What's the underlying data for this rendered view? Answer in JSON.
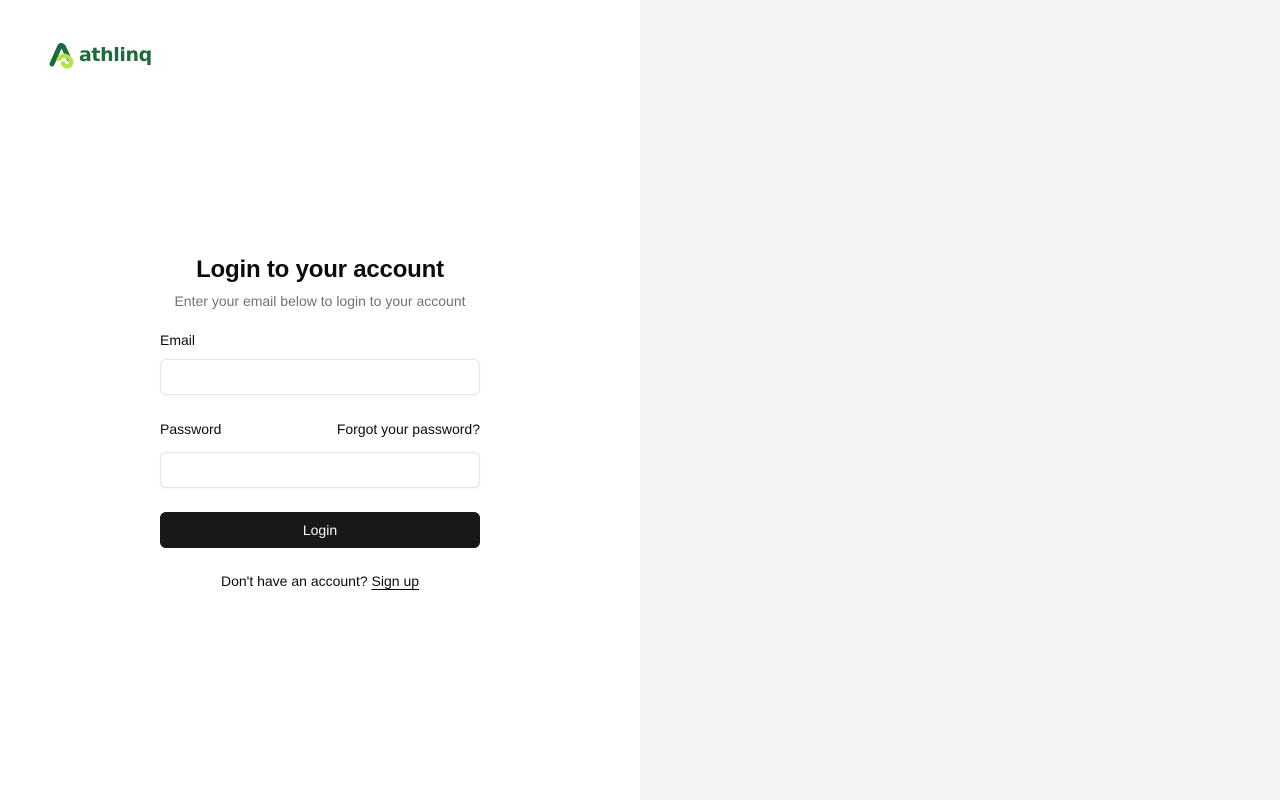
{
  "brand": {
    "name": "athlinq",
    "logo_icon": "athlinq-logo-mark",
    "color_primary": "#1d6b3c",
    "color_secondary": "#b8e04a"
  },
  "login_form": {
    "title": "Login to your account",
    "subtitle": "Enter your email below to login to your account",
    "email": {
      "label": "Email",
      "value": "",
      "placeholder": ""
    },
    "password": {
      "label": "Password",
      "value": "",
      "placeholder": ""
    },
    "forgot_password_link": "Forgot your password?",
    "submit_label": "Login",
    "signup_prompt": "Don't have an account?",
    "signup_link": "Sign up"
  },
  "colors": {
    "button_background": "#18181a",
    "right_panel_background": "#f3f3f3",
    "muted_text": "#737373",
    "input_border": "#e5e5e5"
  }
}
